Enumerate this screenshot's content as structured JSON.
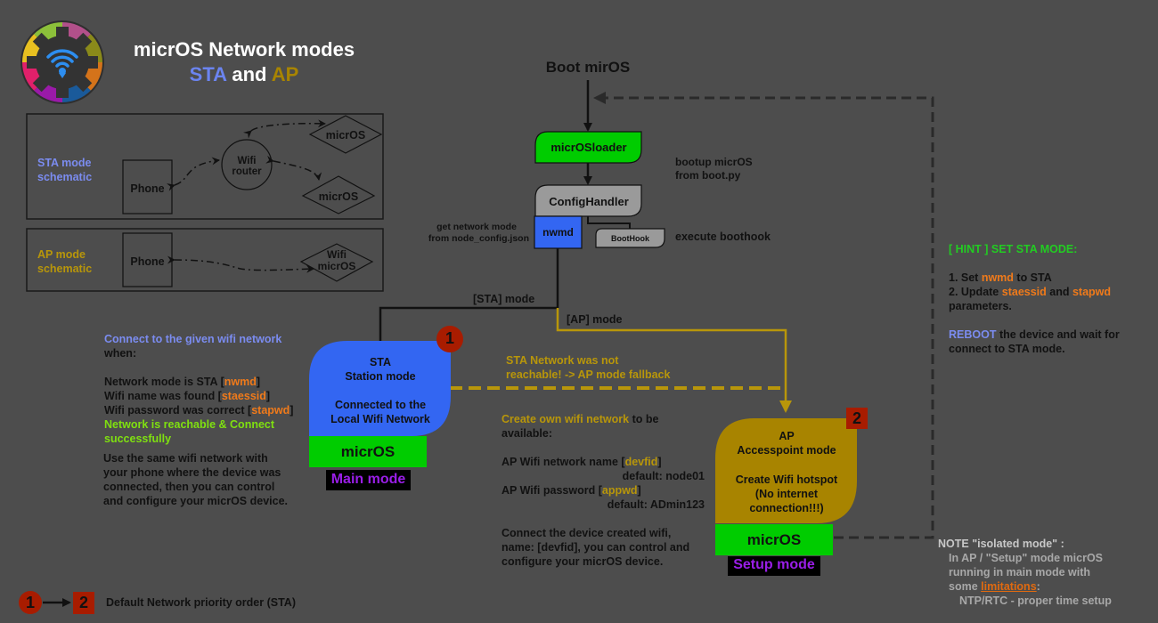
{
  "header": {
    "title": "micrOS Network modes",
    "subtitle_sta": "STA",
    "subtitle_and": "and",
    "subtitle_ap": "AP",
    "logo_icon": "micros-gear-wifi-logo"
  },
  "colors": {
    "background": "#4d4d4d",
    "sta_blue": "#3366f2",
    "sta_text": "#7b8cf0",
    "ap_gold": "#a88400",
    "ap_text": "#b8960a",
    "micros_green": "#00cc00",
    "param_orange": "#f07a1a",
    "success_green": "#7fe010",
    "hint_green": "#22cc22",
    "badge_red": "#a81c00",
    "mode_purple": "#9a1ee8",
    "configurator_gray": "#9a9a9a"
  },
  "sta_schematic": {
    "label_line1": "STA mode",
    "label_line2": "schematic",
    "phone": "Phone",
    "router_line1": "Wifi",
    "router_line2": "router",
    "node1": "micrOS",
    "node2": "micrOS"
  },
  "ap_schematic": {
    "label_line1": "AP mode",
    "label_line2": "schematic",
    "phone": "Phone",
    "node_line1": "Wifi",
    "node_line2": "micrOS"
  },
  "flow": {
    "boot": "Boot mirOS",
    "loader": "micrOSloader",
    "loader_note_line1": "bootup micrOS",
    "loader_note_line2": "from boot.py",
    "config_handler": "ConfigHandler",
    "nwmd": "nwmd",
    "nwmd_note_line1": "get network mode",
    "nwmd_note_line2": "from node_config.json",
    "boothook": "BootHook",
    "boothook_note": "execute boothook",
    "sta_branch": "[STA] mode",
    "ap_branch": "[AP] mode",
    "fallback_line1": "STA Network was not",
    "fallback_line2": "reachable! -> AP mode fallback"
  },
  "sta_node": {
    "line1": "STA",
    "line2": "Station mode",
    "line3": "Connected to the",
    "line4": "Local Wifi Network",
    "micros": "micrOS",
    "mode": "Main mode",
    "badge": "1"
  },
  "ap_node": {
    "line1": "AP",
    "line2": "Accesspoint mode",
    "line3": "Create Wifi hotspot",
    "line4": "(No internet",
    "line5": "connection!!!)",
    "micros": "micrOS",
    "mode": "Setup mode",
    "badge": "2"
  },
  "sta_desc": {
    "intro_colored": "Connect to the given wifi network",
    "intro_rest": "when:",
    "cond1_pre": "Network mode is STA [",
    "cond1_param": "nwmd",
    "cond1_post": "]",
    "cond2_pre": "Wifi name was found [",
    "cond2_param": "staessid",
    "cond2_post": "]",
    "cond3_pre": "Wifi password was correct [",
    "cond3_param": "stapwd",
    "cond3_post": "]",
    "success_line1": "Network is reachable & Connect",
    "success_line2": "successfully",
    "usage_line1": "Use the same wifi network with",
    "usage_line2": "your phone where the device was",
    "usage_line3": "connected, then you can control",
    "usage_line4": "and configure your micrOS device."
  },
  "ap_desc": {
    "intro_colored": "Create own wifi network",
    "intro_rest": " to be",
    "intro_line2": "available:",
    "name_pre": "AP Wifi network name [",
    "name_param": "devfid",
    "name_post": "]",
    "name_default": "default: node01",
    "pwd_pre": "AP Wifi password [",
    "pwd_param": "appwd",
    "pwd_post": "]",
    "pwd_default": "default: ADmin123",
    "connect_line1": "Connect the device created wifi,",
    "connect_line2": "name: [devfid], you can control and",
    "connect_line3": "configure your micrOS device."
  },
  "hint": {
    "title": "[ HINT ] SET STA MODE:",
    "step1_pre": "1. Set ",
    "step1_param": "nwmd",
    "step1_post": " to STA",
    "step2_pre": "2. Update ",
    "step2_param1": "staessid",
    "step2_mid": " and ",
    "step2_param2": "stapwd",
    "step2_line2": "parameters.",
    "reboot_colored": "REBOOT",
    "reboot_rest": " the device and wait for",
    "reboot_line2": "connect to STA mode."
  },
  "note": {
    "title": "NOTE \"isolated mode\" :",
    "line1": "In AP / \"Setup\" mode micrOS",
    "line2": "running in main mode with",
    "line3_pre": "some ",
    "line3_link": "limitations",
    "line3_post": ":",
    "line4": "NTP/RTC - proper time setup"
  },
  "legend": {
    "badge1": "1",
    "badge2": "2",
    "text": "Default Network priority order (STA)"
  }
}
